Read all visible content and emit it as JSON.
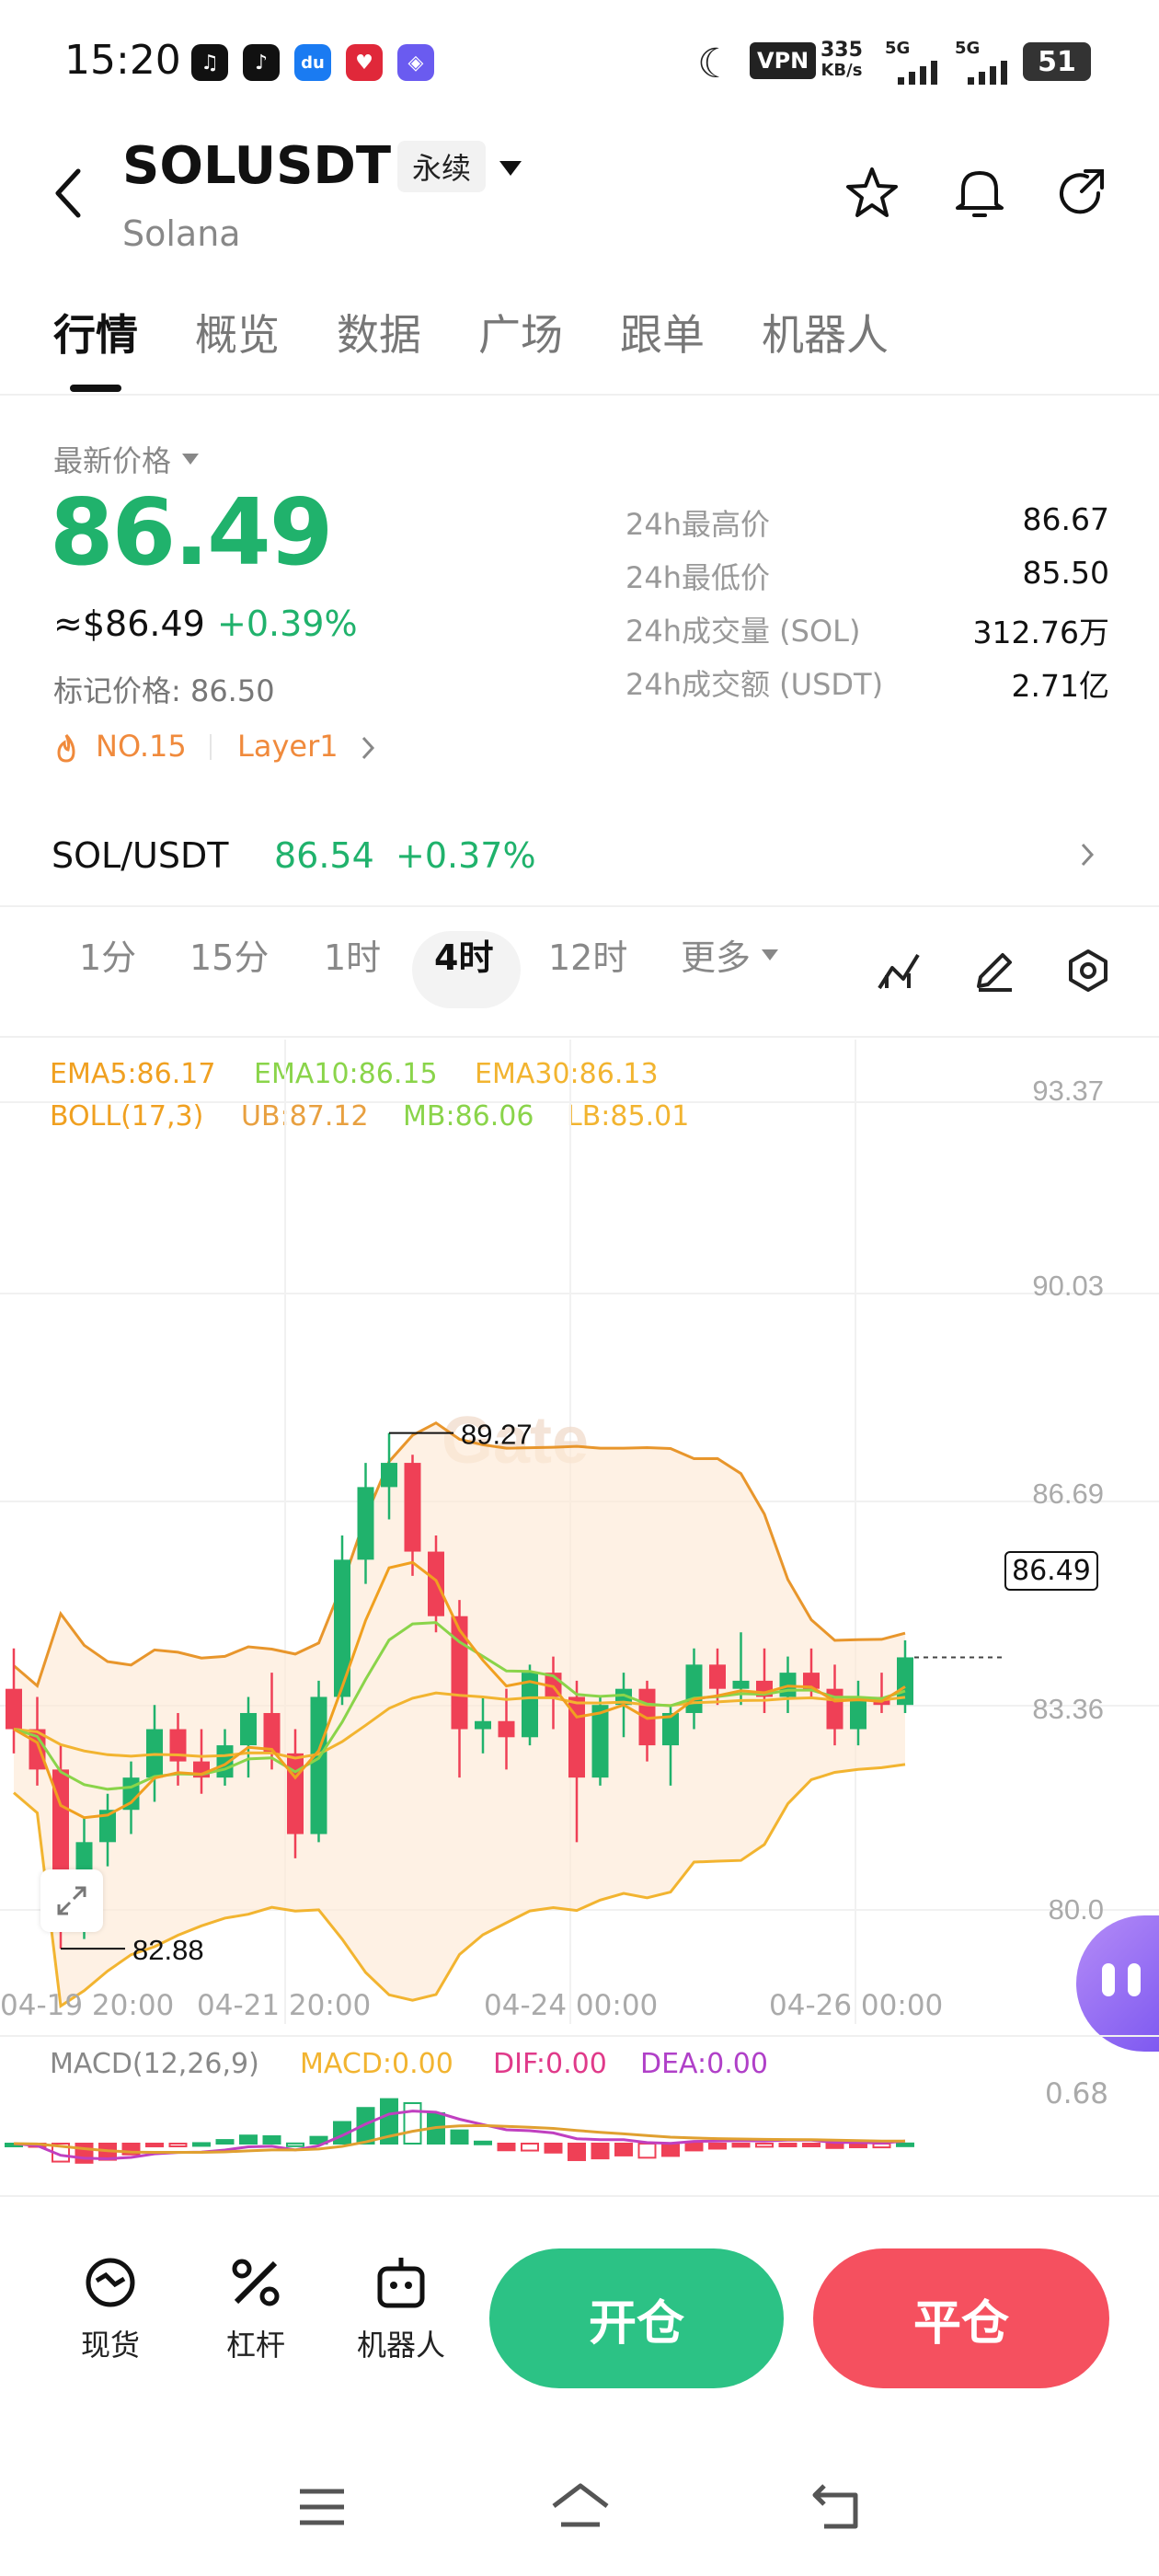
{
  "status_bar": {
    "time": "15:20",
    "vpn": "VPN",
    "speed_value": "335",
    "speed_unit": "KB/s",
    "net1": "5G",
    "net2": "5G",
    "battery": "51"
  },
  "header": {
    "symbol": "SOLUSDT",
    "perp_label": "永续",
    "name": "Solana"
  },
  "tabs": [
    "行情",
    "概览",
    "数据",
    "广场",
    "跟单",
    "机器人"
  ],
  "price": {
    "label": "最新价格",
    "last": "86.49",
    "usd": "≈$86.49",
    "change": "+0.39%",
    "mark": "标记价格: 86.50",
    "rank": "NO.15",
    "tag": "Layer1"
  },
  "stats": [
    {
      "label": "24h最高价",
      "value": "86.67"
    },
    {
      "label": "24h最低价",
      "value": "85.50"
    },
    {
      "label": "24h成交量 (SOL)",
      "value": "312.76万"
    },
    {
      "label": "24h成交额 (USDT)",
      "value": "2.71亿"
    }
  ],
  "spot": {
    "pair": "SOL/USDT",
    "price": "86.54",
    "change": "+0.37%"
  },
  "intervals": [
    "1分",
    "15分",
    "1时",
    "4时",
    "12时",
    "更多"
  ],
  "active_interval": "4时",
  "kline": {
    "ema5": "EMA5:86.17",
    "ema10": "EMA10:86.15",
    "ema30": "EMA30:86.13",
    "boll": "BOLL(17,3)",
    "ub": "UB:87.12",
    "mb": "MB:86.06",
    "lb": "LB:85.01",
    "price_ticks": [
      "93.37",
      "90.03",
      "86.69",
      "83.36",
      "80.0"
    ],
    "current_price": "86.49",
    "high_marker": "89.27",
    "low_marker": "82.88",
    "watermark": "Gate",
    "time_ticks": [
      "04-19 20:00",
      "04-21 20:00",
      "04-24 00:00",
      "04-26 00:00"
    ],
    "colors": {
      "up": "#20b26c",
      "down": "#ef4056",
      "ema5": "#f0a020",
      "ema10": "#8ad44a",
      "ema30": "#f2b430",
      "boll": "#e8a040"
    }
  },
  "chart_data": {
    "type": "candlestick",
    "ylim": [
      80.0,
      93.37
    ],
    "candles": [
      {
        "o": 86.1,
        "h": 86.6,
        "l": 85.3,
        "c": 85.6
      },
      {
        "o": 85.6,
        "h": 86.0,
        "l": 84.9,
        "c": 85.1
      },
      {
        "o": 85.1,
        "h": 85.4,
        "l": 82.88,
        "c": 83.1
      },
      {
        "o": 83.1,
        "h": 84.5,
        "l": 83.0,
        "c": 84.2
      },
      {
        "o": 84.2,
        "h": 84.8,
        "l": 83.9,
        "c": 84.6
      },
      {
        "o": 84.6,
        "h": 85.2,
        "l": 84.3,
        "c": 85.0
      },
      {
        "o": 85.0,
        "h": 85.9,
        "l": 84.7,
        "c": 85.6
      },
      {
        "o": 85.6,
        "h": 85.8,
        "l": 84.9,
        "c": 85.2
      },
      {
        "o": 85.2,
        "h": 85.6,
        "l": 84.8,
        "c": 85.0
      },
      {
        "o": 85.0,
        "h": 85.6,
        "l": 84.9,
        "c": 85.4
      },
      {
        "o": 85.4,
        "h": 86.0,
        "l": 85.0,
        "c": 85.8
      },
      {
        "o": 85.8,
        "h": 86.3,
        "l": 85.1,
        "c": 85.3
      },
      {
        "o": 85.3,
        "h": 85.6,
        "l": 84.0,
        "c": 84.3
      },
      {
        "o": 84.3,
        "h": 86.2,
        "l": 84.2,
        "c": 86.0
      },
      {
        "o": 86.0,
        "h": 88.0,
        "l": 85.9,
        "c": 87.7
      },
      {
        "o": 87.7,
        "h": 88.9,
        "l": 87.4,
        "c": 88.6
      },
      {
        "o": 88.6,
        "h": 89.27,
        "l": 88.2,
        "c": 88.9
      },
      {
        "o": 88.9,
        "h": 89.0,
        "l": 87.5,
        "c": 87.8
      },
      {
        "o": 87.8,
        "h": 88.0,
        "l": 86.8,
        "c": 87.0
      },
      {
        "o": 87.0,
        "h": 87.2,
        "l": 85.0,
        "c": 85.6
      },
      {
        "o": 85.6,
        "h": 86.0,
        "l": 85.3,
        "c": 85.7
      },
      {
        "o": 85.7,
        "h": 86.1,
        "l": 85.1,
        "c": 85.5
      },
      {
        "o": 85.5,
        "h": 86.4,
        "l": 85.4,
        "c": 86.3
      },
      {
        "o": 86.3,
        "h": 86.5,
        "l": 85.6,
        "c": 86.0
      },
      {
        "o": 86.0,
        "h": 86.2,
        "l": 84.2,
        "c": 85.0
      },
      {
        "o": 85.0,
        "h": 86.0,
        "l": 84.9,
        "c": 85.9
      },
      {
        "o": 85.9,
        "h": 86.3,
        "l": 85.5,
        "c": 86.1
      },
      {
        "o": 86.1,
        "h": 86.2,
        "l": 85.2,
        "c": 85.4
      },
      {
        "o": 85.4,
        "h": 85.9,
        "l": 84.9,
        "c": 85.8
      },
      {
        "o": 85.8,
        "h": 86.6,
        "l": 85.6,
        "c": 86.4
      },
      {
        "o": 86.4,
        "h": 86.6,
        "l": 85.9,
        "c": 86.1
      },
      {
        "o": 86.1,
        "h": 86.8,
        "l": 85.9,
        "c": 86.2
      },
      {
        "o": 86.2,
        "h": 86.6,
        "l": 85.8,
        "c": 86.0
      },
      {
        "o": 86.0,
        "h": 86.5,
        "l": 85.8,
        "c": 86.3
      },
      {
        "o": 86.3,
        "h": 86.6,
        "l": 86.0,
        "c": 86.1
      },
      {
        "o": 86.1,
        "h": 86.4,
        "l": 85.4,
        "c": 85.6
      },
      {
        "o": 85.6,
        "h": 86.2,
        "l": 85.4,
        "c": 86.0
      },
      {
        "o": 86.0,
        "h": 86.3,
        "l": 85.8,
        "c": 85.9
      },
      {
        "o": 85.9,
        "h": 86.7,
        "l": 85.8,
        "c": 86.49
      }
    ],
    "macd_label": "MACD(12,26,9)",
    "macd_value": "MACD:0.00",
    "dif": "DIF:0.00",
    "dea": "DEA:0.00",
    "macd_axis": "0.68"
  },
  "actions": {
    "spot": "现货",
    "leverage": "杠杆",
    "bot": "机器人",
    "open": "开仓",
    "close": "平仓"
  }
}
